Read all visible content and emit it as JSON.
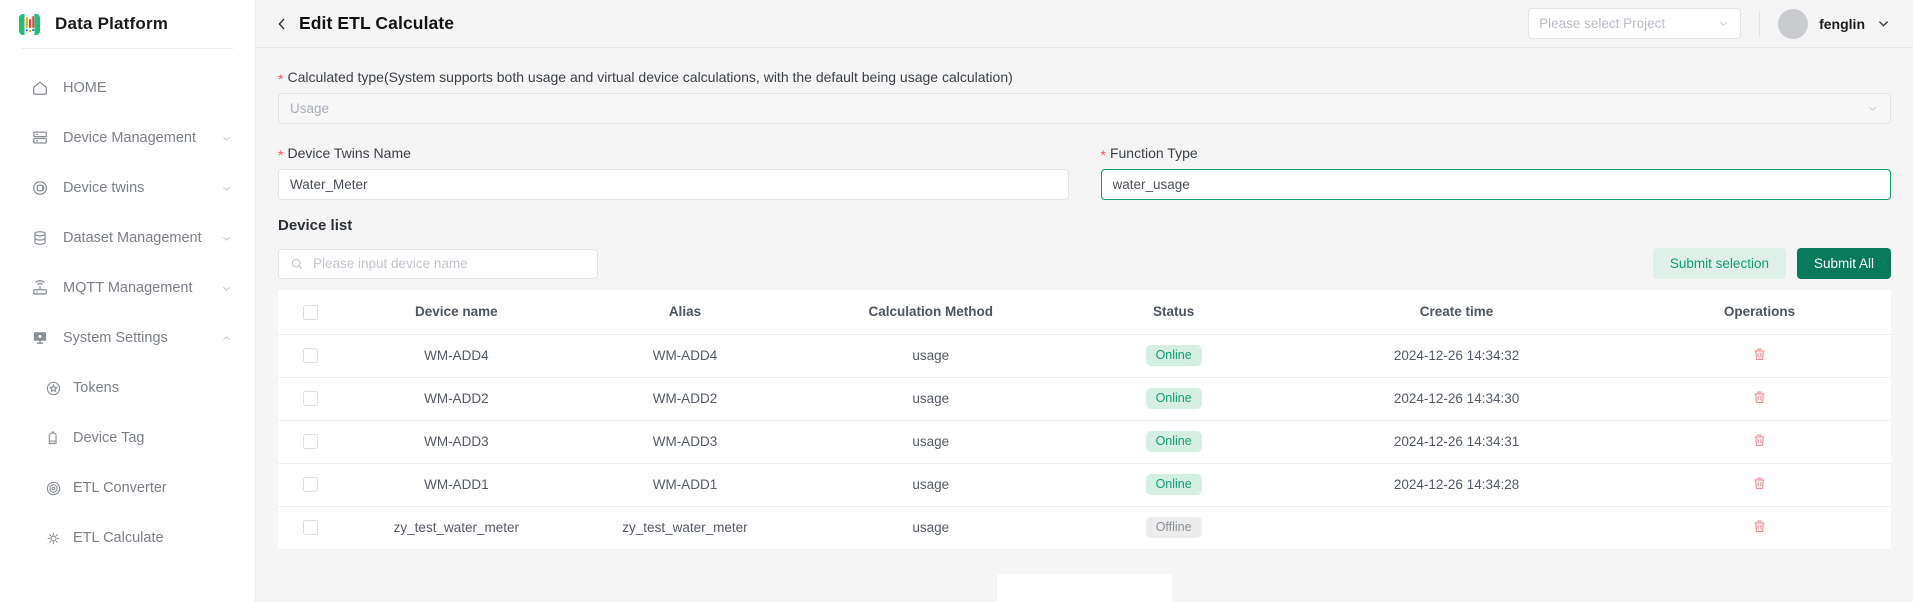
{
  "brand": {
    "name": "Data Platform",
    "logo_icon": "data-platform-logo-icon"
  },
  "sidebar": {
    "items": [
      {
        "label": "HOME",
        "icon": "home-icon",
        "expandable": false,
        "sub": false
      },
      {
        "label": "Device Management",
        "icon": "server-icon",
        "expandable": true,
        "sub": false
      },
      {
        "label": "Device twins",
        "icon": "twins-icon",
        "expandable": true,
        "sub": false
      },
      {
        "label": "Dataset Management",
        "icon": "database-icon",
        "expandable": true,
        "sub": false
      },
      {
        "label": "MQTT Management",
        "icon": "router-icon",
        "expandable": true,
        "sub": false
      },
      {
        "label": "System Settings",
        "icon": "monitor-icon",
        "expandable": true,
        "expanded": true,
        "sub": false
      },
      {
        "label": "Tokens",
        "icon": "token-star-icon",
        "expandable": false,
        "sub": true
      },
      {
        "label": "Device Tag",
        "icon": "tag-icon",
        "expandable": false,
        "sub": true
      },
      {
        "label": "ETL Converter",
        "icon": "converter-icon",
        "expandable": false,
        "sub": true
      },
      {
        "label": "ETL Calculate",
        "icon": "calculate-icon",
        "expandable": false,
        "sub": true
      }
    ]
  },
  "topbar": {
    "back_icon": "chevron-left-icon",
    "title": "Edit ETL Calculate",
    "project_select": {
      "placeholder": "Please select Project",
      "value": "",
      "chevron_icon": "chevron-down-icon"
    },
    "user": {
      "name": "fenglin",
      "avatar_icon": "avatar",
      "chevron_icon": "chevron-down-icon"
    }
  },
  "form": {
    "calculated_type": {
      "label": "Calculated type(System supports both usage and virtual device calculations, with the default being usage calculation)",
      "required": true,
      "value": "Usage",
      "disabled": true,
      "chevron_icon": "chevron-down-icon"
    },
    "device_twins_name": {
      "label": "Device Twins Name",
      "required": true,
      "value": "Water_Meter",
      "placeholder": ""
    },
    "function_type": {
      "label": "Function Type",
      "required": true,
      "value": "water_usage",
      "placeholder": "",
      "focused": true
    }
  },
  "device_list": {
    "title": "Device list",
    "search": {
      "placeholder": "Please input device name",
      "value": "",
      "icon": "search-icon"
    },
    "submit_selection_label": "Submit selection",
    "submit_all_label": "Submit All",
    "columns": [
      "",
      "Device name",
      "Alias",
      "Calculation Method",
      "Status",
      "Create time",
      "Operations"
    ],
    "rows": [
      {
        "checked": false,
        "device_name": "WM-ADD4",
        "alias": "WM-ADD4",
        "calculation_method": "usage",
        "status": "Online",
        "create_time": "2024-12-26 14:34:32",
        "operation_icon": "delete-icon"
      },
      {
        "checked": false,
        "device_name": "WM-ADD2",
        "alias": "WM-ADD2",
        "calculation_method": "usage",
        "status": "Online",
        "create_time": "2024-12-26 14:34:30",
        "operation_icon": "delete-icon"
      },
      {
        "checked": false,
        "device_name": "WM-ADD3",
        "alias": "WM-ADD3",
        "calculation_method": "usage",
        "status": "Online",
        "create_time": "2024-12-26 14:34:31",
        "operation_icon": "delete-icon"
      },
      {
        "checked": false,
        "device_name": "WM-ADD1",
        "alias": "WM-ADD1",
        "calculation_method": "usage",
        "status": "Online",
        "create_time": "2024-12-26 14:34:28",
        "operation_icon": "delete-icon"
      },
      {
        "checked": false,
        "device_name": "zy_test_water_meter",
        "alias": "zy_test_water_meter",
        "calculation_method": "usage",
        "status": "Offline",
        "create_time": "",
        "operation_icon": "delete-icon"
      }
    ]
  },
  "colors": {
    "brand_green": "#0f9d76",
    "primary_button": "#077a5c",
    "ghost_button_bg": "#dff0e9",
    "required_red": "#f5515f",
    "delete_red": "#f08a8f",
    "online_badge_bg": "#d6efe3",
    "offline_badge_bg": "#ececec",
    "page_bg": "#f5f5f5"
  }
}
